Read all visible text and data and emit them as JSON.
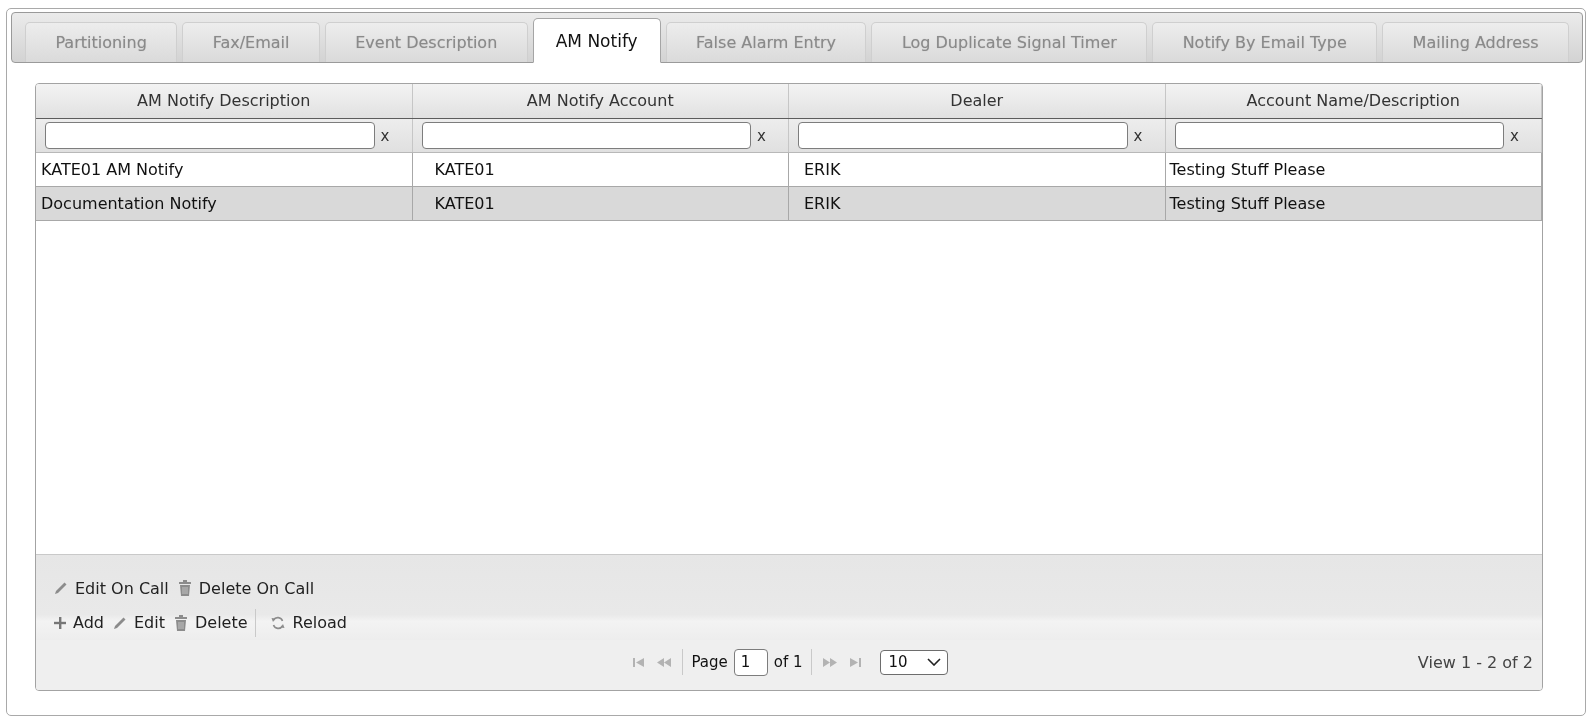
{
  "tabs": [
    {
      "label": "Partitioning",
      "selected": false
    },
    {
      "label": "Fax/Email",
      "selected": false
    },
    {
      "label": "Event Description",
      "selected": false
    },
    {
      "label": "AM Notify",
      "selected": true
    },
    {
      "label": "False Alarm Entry",
      "selected": false
    },
    {
      "label": "Log Duplicate Signal Timer",
      "selected": false
    },
    {
      "label": "Notify By Email Type",
      "selected": false
    },
    {
      "label": "Mailing Address",
      "selected": false
    }
  ],
  "grid": {
    "columns": [
      {
        "label": "AM Notify Description"
      },
      {
        "label": "AM Notify Account"
      },
      {
        "label": "Dealer"
      },
      {
        "label": "Account Name/Description"
      }
    ],
    "filters": [
      {
        "clear_label": "x"
      },
      {
        "clear_label": "x"
      },
      {
        "clear_label": "x"
      },
      {
        "clear_label": "x"
      }
    ],
    "rows": [
      {
        "selected": false,
        "cells": [
          "KATE01 AM Notify",
          "KATE01",
          "ERIK",
          "Testing Stuff Please"
        ]
      },
      {
        "selected": true,
        "cells": [
          "Documentation Notify",
          "KATE01",
          "ERIK",
          "Testing Stuff Please"
        ]
      }
    ],
    "toolbar": {
      "rows": [
        {
          "groups": [
            {
              "buttons": [
                {
                  "kind": "edit",
                  "label": "Edit On Call"
                },
                {
                  "kind": "delete",
                  "label": "Delete On Call"
                }
              ]
            }
          ]
        },
        {
          "groups": [
            {
              "buttons": [
                {
                  "kind": "add",
                  "label": "Add"
                },
                {
                  "kind": "edit",
                  "label": "Edit"
                },
                {
                  "kind": "delete",
                  "label": "Delete"
                }
              ]
            },
            {
              "buttons": [
                {
                  "kind": "reload",
                  "label": "Reload"
                }
              ]
            }
          ]
        }
      ]
    },
    "pager": {
      "nav_back": [
        {
          "kind": "first",
          "disabled": true
        },
        {
          "kind": "prev",
          "disabled": true
        }
      ],
      "page_label": "Page",
      "page": "1",
      "of_label": "of 1",
      "nav_forward": [
        {
          "kind": "next",
          "disabled": true
        },
        {
          "kind": "last",
          "disabled": true
        }
      ],
      "page_size": "10",
      "summary": "View 1 - 2 of 2"
    }
  }
}
